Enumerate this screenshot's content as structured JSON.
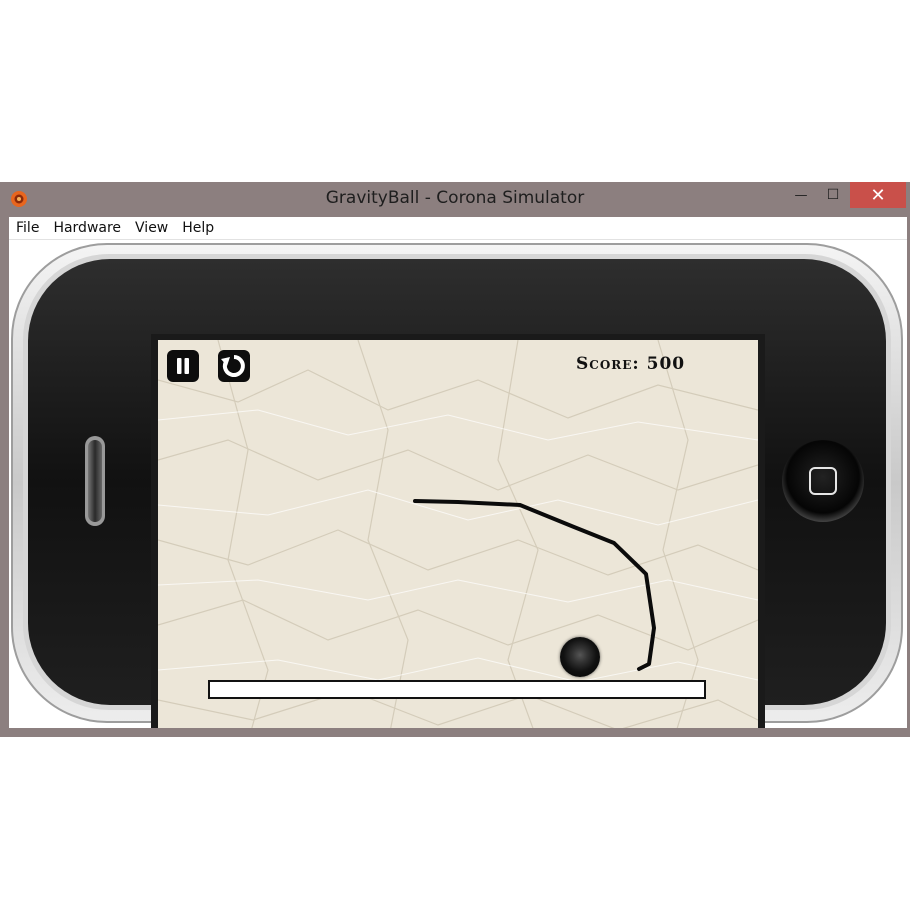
{
  "window": {
    "title": "GravityBall - Corona Simulator",
    "minimize_glyph": "—",
    "maximize_glyph": "☐",
    "close_glyph": "✕"
  },
  "menu": {
    "items": [
      {
        "label": "File"
      },
      {
        "label": "Hardware"
      },
      {
        "label": "View"
      },
      {
        "label": "Help"
      }
    ]
  },
  "game": {
    "score_label": "Score:",
    "score_value": "500",
    "pause_icon": "pause-icon",
    "restart_icon": "restart-icon"
  },
  "colors": {
    "window_frame": "#8c7f7f",
    "close_button": "#c9504a",
    "paper": "#ece6d8",
    "ink": "#111111"
  }
}
